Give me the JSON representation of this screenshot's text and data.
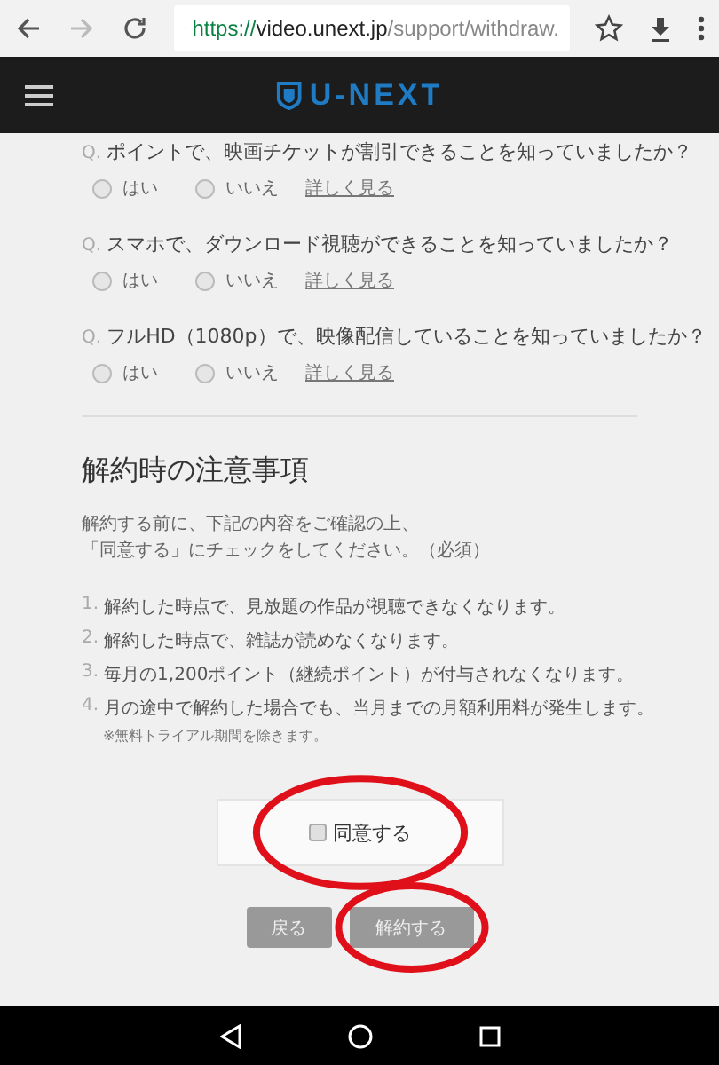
{
  "browser": {
    "url_scheme": "https://",
    "url_host": "video.unext.jp",
    "url_path": "/support/withdraw."
  },
  "header": {
    "logo": "U-NEXT"
  },
  "questions": [
    {
      "prefix": "Q.",
      "text": "ポイントで、映画チケットが割引できることを知っていましたか？",
      "options": [
        {
          "label": "はい",
          "selected": false
        },
        {
          "label": "いいえ",
          "selected": false
        }
      ],
      "link": "詳しく見る"
    },
    {
      "prefix": "Q.",
      "text": "スマホで、ダウンロード視聴ができることを知っていましたか？",
      "options": [
        {
          "label": "はい",
          "selected": false
        },
        {
          "label": "いいえ",
          "selected": false
        }
      ],
      "link": "詳しく見る"
    },
    {
      "prefix": "Q.",
      "text": "フルHD（1080p）で、映像配信していることを知っていましたか？",
      "options": [
        {
          "label": "はい",
          "selected": false
        },
        {
          "label": "いいえ",
          "selected": false
        }
      ],
      "link": "詳しく見る"
    }
  ],
  "notice": {
    "title": "解約時の注意事項",
    "intro": [
      "解約する前に、下記の内容をご確認の上、",
      "「同意する」にチェックをしてください。（必須）"
    ],
    "items": [
      {
        "number": "1.",
        "text": "解約した時点で、見放題の作品が視聴できなくなります。"
      },
      {
        "number": "2.",
        "text": "解約した時点で、雑誌が読めなくなります。"
      },
      {
        "number": "3.",
        "text": "毎月の1,200ポイント（継続ポイント）が付与されなくなります。"
      },
      {
        "number": "4.",
        "text": "月の途中で解約した場合でも、当月までの月額利用料が発生します。",
        "note": "※無料トライアル期間を除きます。"
      }
    ]
  },
  "agree": {
    "label": "同意する",
    "checked": false,
    "circled": true
  },
  "buttons": [
    {
      "label": "戻る",
      "circled": false
    },
    {
      "label": "解約する",
      "circled": true
    }
  ]
}
